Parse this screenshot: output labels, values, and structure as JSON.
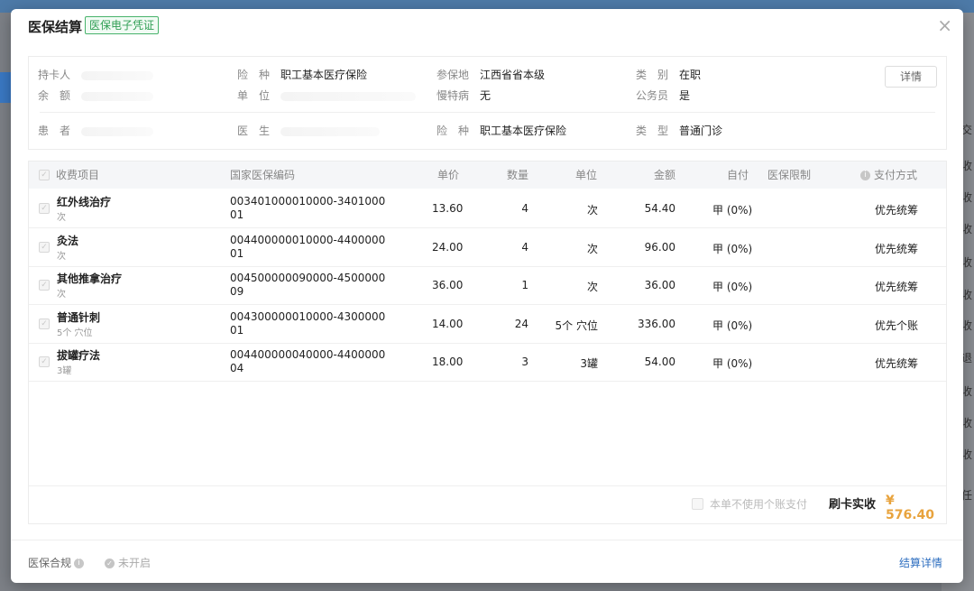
{
  "background": {
    "right_items": [
      "交",
      "收",
      "收",
      "收",
      "收",
      "收",
      "收",
      "退",
      "收",
      "收",
      "收",
      "任"
    ]
  },
  "modal": {
    "title": "医保结算",
    "tag": "医保电子凭证",
    "close": "×"
  },
  "info": {
    "row1": [
      {
        "label": "持卡人",
        "value": ""
      },
      {
        "label": "险　种",
        "value": "职工基本医疗保险"
      },
      {
        "label": "参保地",
        "value": "江西省省本级"
      },
      {
        "label": "类　别",
        "value": "在职"
      }
    ],
    "row2": [
      {
        "label": "余　额",
        "value": ""
      },
      {
        "label": "单　位",
        "value": ""
      },
      {
        "label": "慢特病",
        "value": "无"
      },
      {
        "label": "公务员",
        "value": "是"
      }
    ],
    "row3": [
      {
        "label": "患　者",
        "value": ""
      },
      {
        "label": "医　生",
        "value": ""
      },
      {
        "label": "险　种",
        "value": "职工基本医疗保险"
      },
      {
        "label": "类　型",
        "value": "普通门诊"
      }
    ],
    "detail_button": "详情"
  },
  "table": {
    "headers": {
      "item": "收费项目",
      "code": "国家医保编码",
      "price": "单价",
      "qty": "数量",
      "unit": "单位",
      "amount": "金额",
      "self_pay": "自付",
      "limit": "医保限制",
      "pay_method": "支付方式"
    },
    "rows": [
      {
        "name": "红外线治疗",
        "sub": "次",
        "code": "003401000010000-340100001",
        "price": "13.60",
        "qty": "4",
        "unit": "次",
        "amount": "54.40",
        "self_pay": "甲 (0%)",
        "pay_method": "优先统筹"
      },
      {
        "name": "灸法",
        "sub": "次",
        "code": "004400000010000-440000001",
        "price": "24.00",
        "qty": "4",
        "unit": "次",
        "amount": "96.00",
        "self_pay": "甲 (0%)",
        "pay_method": "优先统筹"
      },
      {
        "name": "其他推拿治疗",
        "sub": "次",
        "code": "004500000090000-450000009",
        "price": "36.00",
        "qty": "1",
        "unit": "次",
        "amount": "36.00",
        "self_pay": "甲 (0%)",
        "pay_method": "优先统筹"
      },
      {
        "name": "普通针刺",
        "sub": "5个 穴位",
        "code": "004300000010000-430000001",
        "price": "14.00",
        "qty": "24",
        "unit": "5个 穴位",
        "amount": "336.00",
        "self_pay": "甲 (0%)",
        "pay_method": "优先个账"
      },
      {
        "name": "拔罐疗法",
        "sub": "3罐",
        "code": "004400000040000-440000004",
        "price": "18.00",
        "qty": "3",
        "unit": "3罐",
        "amount": "54.00",
        "self_pay": "甲 (0%)",
        "pay_method": "优先统筹"
      }
    ]
  },
  "summary": {
    "no_personal_account": "本单不使用个账支付",
    "total_label": "刷卡实收",
    "total_value": "¥ 576.40"
  },
  "footer": {
    "compliance": "医保合规",
    "status": "未开启",
    "settle_details": "结算详情"
  }
}
